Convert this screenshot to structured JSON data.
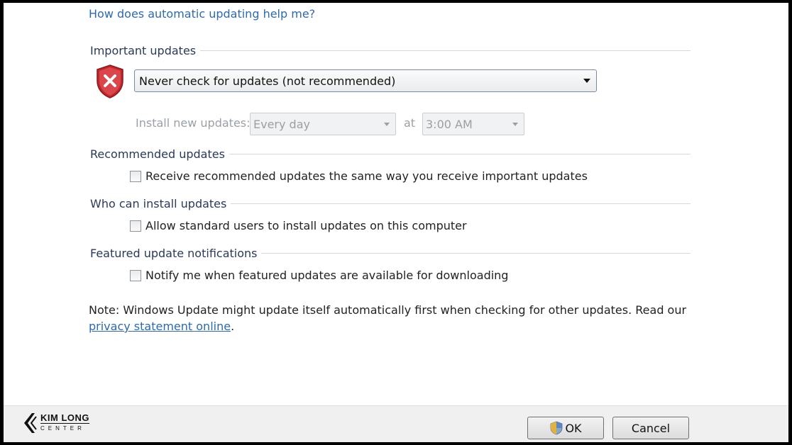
{
  "help_link": "How does automatic updating help me?",
  "important": {
    "title": "Important updates",
    "selected": "Never check for updates (not recommended)",
    "install_label": "Install new updates:",
    "day_value": "Every day",
    "at_label": "at",
    "time_value": "3:00 AM"
  },
  "recommended": {
    "title": "Recommended updates",
    "checkbox_label": "Receive recommended updates the same way you receive important updates",
    "checked": false
  },
  "who": {
    "title": "Who can install updates",
    "checkbox_label": "Allow standard users to install updates on this computer",
    "checked": false
  },
  "featured": {
    "title": "Featured update notifications",
    "checkbox_label": "Notify me when featured updates are available for downloading",
    "checked": false
  },
  "note": {
    "text": "Note: Windows Update might update itself automatically first when checking for other updates.  Read our",
    "link": "privacy statement online",
    "end": "."
  },
  "buttons": {
    "ok": "OK",
    "cancel": "Cancel"
  },
  "logo": {
    "line1": "KIM LONG",
    "line2": "CENTER"
  },
  "colors": {
    "link": "#2f6aa8",
    "shield": "#c0272d"
  }
}
